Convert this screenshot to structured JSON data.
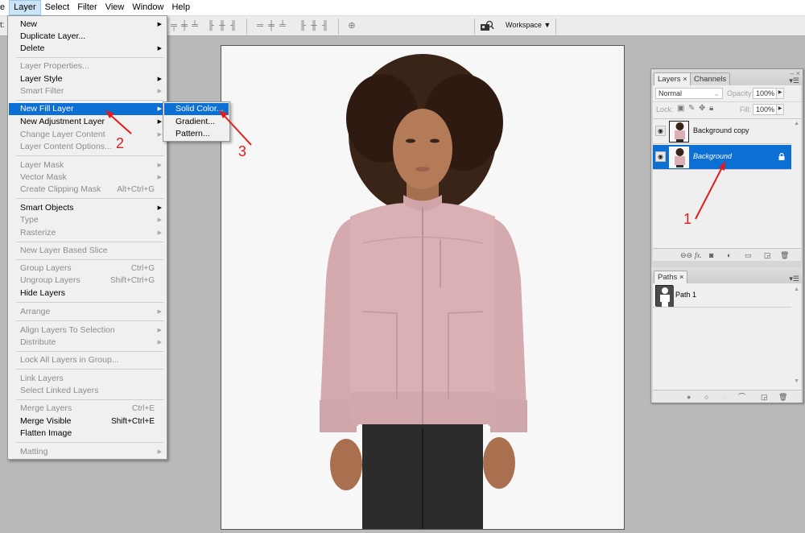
{
  "menubar": {
    "items": [
      {
        "label": "e"
      },
      {
        "label": "Layer",
        "active": true
      },
      {
        "label": "Select"
      },
      {
        "label": "Filter"
      },
      {
        "label": "View"
      },
      {
        "label": "Window"
      },
      {
        "label": "Help"
      }
    ]
  },
  "optionsbar": {
    "left_label": "t:",
    "workspace_label": "Workspace ▼",
    "icons": [
      "align-top-edges-icon",
      "align-vertical-centers-icon",
      "align-bottom-edges-icon",
      "align-left-edges-icon",
      "align-horizontal-centers-icon",
      "align-right-edges-icon",
      "distribute-top-icon",
      "distribute-vertical-centers-icon",
      "distribute-bottom-icon",
      "distribute-left-icon",
      "distribute-horizontal-centers-icon",
      "distribute-right-icon",
      "auto-align-layers-icon",
      "bridge-icon"
    ]
  },
  "layer_menu": {
    "items": [
      {
        "label": "New",
        "submenu": true,
        "enabled": true
      },
      {
        "label": "Duplicate Layer...",
        "enabled": true
      },
      {
        "label": "Delete",
        "submenu": true,
        "enabled": true
      },
      {
        "label": "Layer Properties...",
        "enabled": false
      },
      {
        "label": "Layer Style",
        "submenu": true,
        "enabled": true
      },
      {
        "label": "Smart Filter",
        "submenu": true,
        "enabled": false
      },
      {
        "label": "New Fill Layer",
        "submenu": true,
        "enabled": true,
        "highlighted": true
      },
      {
        "label": "New Adjustment Layer",
        "submenu": true,
        "enabled": true
      },
      {
        "label": "Change Layer Content",
        "submenu": true,
        "enabled": false
      },
      {
        "label": "Layer Content Options...",
        "enabled": false
      },
      {
        "label": "Layer Mask",
        "submenu": true,
        "enabled": false
      },
      {
        "label": "Vector Mask",
        "submenu": true,
        "enabled": false
      },
      {
        "label": "Create Clipping Mask",
        "shortcut": "Alt+Ctrl+G",
        "enabled": false
      },
      {
        "label": "Smart Objects",
        "submenu": true,
        "enabled": true
      },
      {
        "label": "Type",
        "submenu": true,
        "enabled": false
      },
      {
        "label": "Rasterize",
        "submenu": true,
        "enabled": false
      },
      {
        "label": "New Layer Based Slice",
        "enabled": false
      },
      {
        "label": "Group Layers",
        "shortcut": "Ctrl+G",
        "enabled": false
      },
      {
        "label": "Ungroup Layers",
        "shortcut": "Shift+Ctrl+G",
        "enabled": false
      },
      {
        "label": "Hide Layers",
        "enabled": true
      },
      {
        "label": "Arrange",
        "submenu": true,
        "enabled": false
      },
      {
        "label": "Align Layers To Selection",
        "submenu": true,
        "enabled": false
      },
      {
        "label": "Distribute",
        "submenu": true,
        "enabled": false
      },
      {
        "label": "Lock All Layers in Group...",
        "enabled": false
      },
      {
        "label": "Link Layers",
        "enabled": false
      },
      {
        "label": "Select Linked Layers",
        "enabled": false
      },
      {
        "label": "Merge Layers",
        "shortcut": "Ctrl+E",
        "enabled": false
      },
      {
        "label": "Merge Visible",
        "shortcut": "Shift+Ctrl+E",
        "enabled": true
      },
      {
        "label": "Flatten Image",
        "enabled": true
      },
      {
        "label": "Matting",
        "submenu": true,
        "enabled": false
      }
    ]
  },
  "fill_submenu": {
    "items": [
      {
        "label": "Solid Color...",
        "highlighted": true
      },
      {
        "label": "Gradient..."
      },
      {
        "label": "Pattern..."
      }
    ]
  },
  "layers_panel": {
    "tabs": [
      {
        "label": "Layers ×",
        "active": true
      },
      {
        "label": "Channels",
        "active": false
      }
    ],
    "blend_mode": "Normal",
    "opacity_label": "Opacity:",
    "opacity_value": "100%",
    "lock_label": "Lock:",
    "fill_label": "Fill:",
    "fill_value": "100%",
    "layers": [
      {
        "name": "Background copy",
        "visible": true,
        "selected": false,
        "locked": false
      },
      {
        "name": "Background",
        "visible": true,
        "selected": true,
        "locked": true
      }
    ],
    "footer_icons": [
      "link-layers-icon",
      "fx-icon",
      "add-mask-icon",
      "adjustment-layer-icon",
      "new-group-icon",
      "new-layer-icon",
      "delete-layer-icon"
    ]
  },
  "paths_panel": {
    "tab_label": "Paths ×",
    "paths": [
      {
        "name": "Path 1"
      }
    ],
    "footer_icons": [
      "fill-path-icon",
      "stroke-path-icon",
      "load-selection-icon",
      "make-work-path-icon",
      "new-path-icon",
      "delete-path-icon"
    ]
  },
  "annotations": [
    {
      "number": "1",
      "target": "Background layer"
    },
    {
      "number": "2",
      "target": "New Fill Layer"
    },
    {
      "number": "3",
      "target": "Solid Color..."
    }
  ],
  "colors": {
    "highlight": "#0b6fd4",
    "annotation": "#e31b1b",
    "jacket": "#d9b1b5"
  }
}
